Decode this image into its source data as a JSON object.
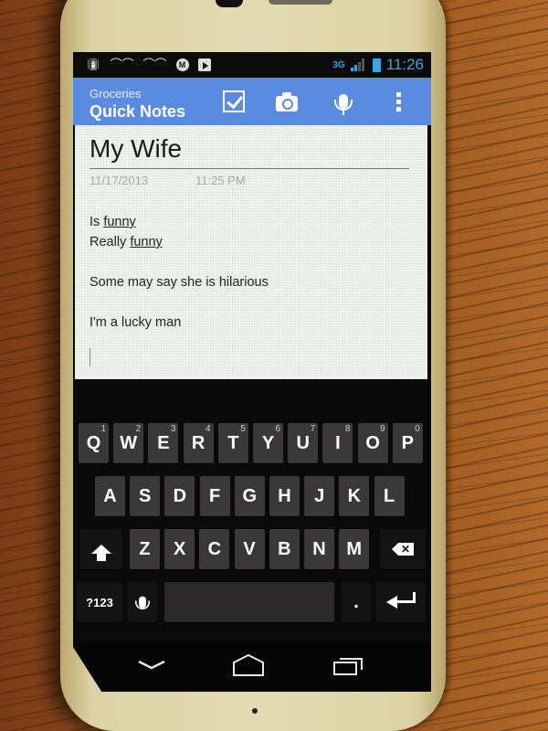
{
  "status_bar": {
    "left_icons": [
      "vibrate-icon",
      "voicemail-icon",
      "voicemail-icon",
      "motorola-icon",
      "play-store-icon"
    ],
    "network": "3G",
    "time": "11:26",
    "accent_color": "#39a6e0"
  },
  "action_bar": {
    "subtitle": "Groceries",
    "title": "Quick Notes",
    "background_color": "#5b8be0",
    "actions": [
      "checkbox-icon",
      "camera-icon",
      "microphone-icon",
      "overflow-menu-icon"
    ]
  },
  "note": {
    "title": "My Wife",
    "date": "11/17/2013",
    "time": "11:25 PM",
    "lines": [
      {
        "prefix": "Is ",
        "underlined": "funny"
      },
      {
        "prefix": "Really ",
        "underlined": "funny"
      },
      {
        "prefix": "",
        "underlined": ""
      },
      {
        "prefix": "Some may say she is hilarious",
        "underlined": ""
      },
      {
        "prefix": "",
        "underlined": ""
      },
      {
        "prefix": "I'm a lucky man",
        "underlined": ""
      }
    ]
  },
  "keyboard": {
    "row1": [
      {
        "label": "Q",
        "hint": "1"
      },
      {
        "label": "W",
        "hint": "2"
      },
      {
        "label": "E",
        "hint": "3"
      },
      {
        "label": "R",
        "hint": "4"
      },
      {
        "label": "T",
        "hint": "5"
      },
      {
        "label": "Y",
        "hint": "6"
      },
      {
        "label": "U",
        "hint": "7"
      },
      {
        "label": "I",
        "hint": "8"
      },
      {
        "label": "O",
        "hint": "9"
      },
      {
        "label": "P",
        "hint": "0"
      }
    ],
    "row2": [
      "A",
      "S",
      "D",
      "F",
      "G",
      "H",
      "J",
      "K",
      "L"
    ],
    "row3": [
      "Z",
      "X",
      "C",
      "V",
      "B",
      "N",
      "M"
    ],
    "symbols_label": "?123",
    "period_label": ".",
    "shift_icon": "shift-icon",
    "backspace_icon": "backspace-icon",
    "enter_icon": "enter-icon",
    "voice_icon": "microphone-icon"
  },
  "nav_bar": {
    "buttons": [
      "back-icon",
      "home-icon",
      "recent-apps-icon"
    ]
  }
}
